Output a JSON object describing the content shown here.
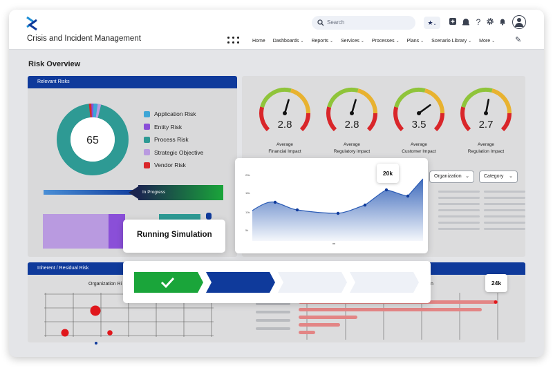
{
  "header": {
    "app_title": "Crisis and Incident Management",
    "search_placeholder": "Search",
    "nav": [
      {
        "label": "Home",
        "has_menu": false
      },
      {
        "label": "Dashboards",
        "has_menu": true
      },
      {
        "label": "Reports",
        "has_menu": true
      },
      {
        "label": "Services",
        "has_menu": true
      },
      {
        "label": "Processes",
        "has_menu": true
      },
      {
        "label": "Plans",
        "has_menu": true
      },
      {
        "label": "Scenario Library",
        "has_menu": true
      },
      {
        "label": "More",
        "has_menu": true
      }
    ],
    "icons": [
      "logo-icon",
      "search-icon",
      "star-icon",
      "add-icon",
      "incident-icon",
      "help-icon",
      "gear-icon",
      "bell-icon",
      "user-icon",
      "grid-icon",
      "pencil-icon"
    ]
  },
  "page": {
    "title": "Risk Overview"
  },
  "relevant_risks": {
    "title": "Relevant Risks",
    "total": "65",
    "legend": [
      {
        "label": "Application Risk",
        "color": "#3ea6d6"
      },
      {
        "label": "Entity Risk",
        "color": "#8a4fd8"
      },
      {
        "label": "Process Risk",
        "color": "#2e9a94"
      },
      {
        "label": "Strategic Objective",
        "color": "#b99ae0"
      },
      {
        "label": "Vendor Risk",
        "color": "#d9262a"
      }
    ],
    "progress_label": "In Progress"
  },
  "gauges": [
    {
      "value": "2.8",
      "label_line1": "Average",
      "label_line2": "Financial Impact",
      "fraction": 0.56
    },
    {
      "value": "2.8",
      "label_line1": "Average",
      "label_line2": "Regulatory impact",
      "fraction": 0.56
    },
    {
      "value": "3.5",
      "label_line1": "Average",
      "label_line2": "Customer Impact",
      "fraction": 0.7
    },
    {
      "value": "2.7",
      "label_line1": "Average",
      "label_line2": "Regulation Impact",
      "fraction": 0.54
    }
  ],
  "filters": {
    "organization": "Organization",
    "category": "Category"
  },
  "area_card": {
    "tooltip": "20k",
    "y_ticks": [
      "20k",
      "15k",
      "10k",
      "5k"
    ]
  },
  "simulation": {
    "title": "Running Simulation",
    "steps": [
      {
        "state": "done",
        "color": "#1aa53a"
      },
      {
        "state": "active",
        "color": "#0f3a9b"
      },
      {
        "state": "pending",
        "color": "#eef1f7"
      },
      {
        "state": "pending",
        "color": "#eef1f7"
      }
    ]
  },
  "inherent_residual": {
    "title": "Inherent / Residual Risk",
    "col_left": "Organization Ri",
    "col_right": "n",
    "tooltip": "24k"
  },
  "colors": {
    "brand": "#0f3a9b",
    "success": "#1aa53a",
    "danger": "#d9262a",
    "teal": "#2e9a94"
  }
}
